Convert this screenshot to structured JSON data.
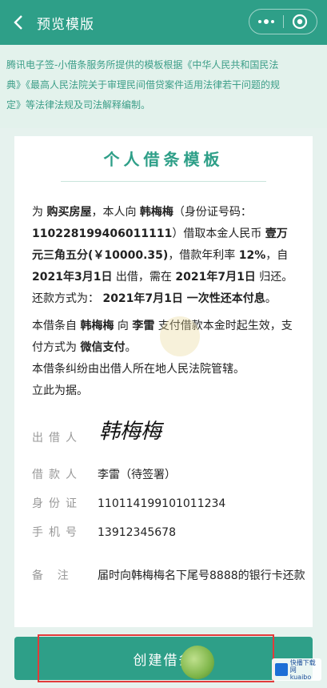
{
  "nav": {
    "title": "预览模版",
    "back_icon": "chevron-left-icon",
    "more_icon": "more-dots-icon",
    "close_icon": "target-close-icon"
  },
  "notice": {
    "line1": "腾讯电子签-小借条服务所提供的模板根据《中华人民共和国民法",
    "line2": "典》《最高人民法院关于审理民间借贷案件适用法律若干问题的规",
    "line3": "定》等法律法规及司法解释编制。"
  },
  "card": {
    "title": "个人借条模板",
    "p1": {
      "t1": "为 ",
      "purpose": "购买房屋",
      "t2": "，本人向 ",
      "lender": "韩梅梅",
      "t3": "（身份证号码：",
      "id_no": "110228199406011111",
      "t4": "）借取本金人民币 ",
      "amount_cn": "壹万元三角五分",
      "amount_num": "(￥10000.35)",
      "t5": "，借款年利率 ",
      "rate": "12%",
      "t6": "，自 ",
      "start": "2021年3月1日",
      "t7": " 出借，需在 ",
      "end": "2021年7月1日",
      "t8": " 归还。还款方式为： ",
      "method": "2021年7月1日 一次性还本付息",
      "t9": "。"
    },
    "p2": {
      "t1": "本借条自 ",
      "lender": "韩梅梅",
      "t2": " 向 ",
      "borrower": "李雷",
      "t3": " 支付借款本金时起生效，支付方式为 ",
      "pay": "微信支付",
      "t4": "。",
      "line2": "本借条纠纷由出借人所在地人民法院管辖。",
      "line3": "立此为据。"
    },
    "info": {
      "lender_label": "出借人",
      "lender_sig": "韩梅梅",
      "borrower_label": "借款人",
      "borrower_value": "李雷（待签署）",
      "id_label": "身份证",
      "id_value": "110114199101011234",
      "phone_label": "手机号",
      "phone_value": "13912345678",
      "note_label": "备    注",
      "note_value": "届时向韩梅梅名下尾号8888的银行卡还款"
    }
  },
  "bottom": {
    "create_label": "创建借条"
  },
  "watermark": {
    "line1": "快播下载网",
    "line2": "kuaibo"
  }
}
